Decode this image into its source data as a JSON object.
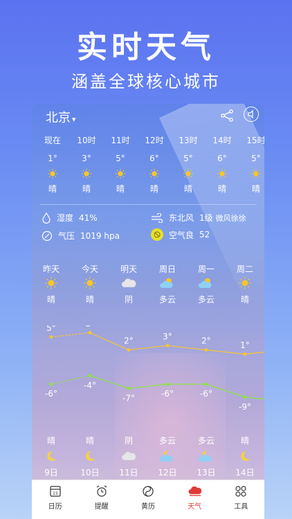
{
  "promo": {
    "title": "实时天气",
    "subtitle": "涵盖全球核心城市"
  },
  "header": {
    "city": "北京",
    "city_dropdown_icon": "chevron-down-icon",
    "share_icon": "share-icon",
    "sound_icon": "speaker-icon"
  },
  "hourly": [
    {
      "time": "现在",
      "temp": "1°",
      "cond": "晴",
      "icon": "sun-icon"
    },
    {
      "time": "10时",
      "temp": "3°",
      "cond": "晴",
      "icon": "sun-icon"
    },
    {
      "time": "11时",
      "temp": "5°",
      "cond": "晴",
      "icon": "sun-icon"
    },
    {
      "time": "12时",
      "temp": "6°",
      "cond": "晴",
      "icon": "sun-icon"
    },
    {
      "time": "13时",
      "temp": "5°",
      "cond": "晴",
      "icon": "sun-icon"
    },
    {
      "time": "14时",
      "temp": "6°",
      "cond": "晴",
      "icon": "sun-icon"
    },
    {
      "time": "15时",
      "temp": "5°",
      "cond": "晴",
      "icon": "sun-icon"
    }
  ],
  "details": {
    "humidity_label": "湿度",
    "humidity_value": "41%",
    "wind_label": "东北风",
    "wind_level": "1级",
    "wind_desc": "微风徐徐",
    "pressure_label": "气压",
    "pressure_value": "1019 hpa",
    "air_label": "空气良",
    "air_value": "52"
  },
  "daily": [
    {
      "day": "昨天",
      "cond": "晴",
      "icon": "sun-icon"
    },
    {
      "day": "今天",
      "cond": "晴",
      "icon": "sun-icon"
    },
    {
      "day": "明天",
      "cond": "阴",
      "icon": "cloud-icon"
    },
    {
      "day": "周日",
      "cond": "多云",
      "icon": "partly-cloudy-icon"
    },
    {
      "day": "周一",
      "cond": "多云",
      "icon": "partly-cloudy-icon"
    },
    {
      "day": "周二",
      "cond": "晴",
      "icon": "sun-icon"
    }
  ],
  "chart_data": {
    "type": "line",
    "categories": [
      "昨天",
      "今天",
      "明天",
      "周日",
      "周一",
      "周二"
    ],
    "series": [
      {
        "values": [
          5,
          6,
          2,
          3,
          2,
          1
        ],
        "color": "#f2c33a"
      },
      {
        "values": [
          -6,
          -4,
          -7,
          -6,
          -6,
          -9
        ],
        "color": "#8fe04a"
      }
    ],
    "high_labels": [
      "5°",
      "6°",
      "2°",
      "3°",
      "2°",
      "1°"
    ],
    "low_labels": [
      "-6°",
      "-4°",
      "-7°",
      "-6°",
      "-6°",
      "-9°"
    ]
  },
  "night": [
    {
      "cond": "晴",
      "date": "9日",
      "icon": "moon-icon"
    },
    {
      "cond": "晴",
      "date": "10日",
      "icon": "moon-icon"
    },
    {
      "cond": "阴",
      "date": "11日",
      "icon": "cloud-icon"
    },
    {
      "cond": "多云",
      "date": "12日",
      "icon": "moon-cloud-icon"
    },
    {
      "cond": "多云",
      "date": "13日",
      "icon": "moon-cloud-icon"
    },
    {
      "cond": "晴",
      "date": "14日",
      "icon": "moon-icon"
    }
  ],
  "tabs": [
    {
      "label": "日历",
      "icon": "calendar-icon",
      "icon_text": "15"
    },
    {
      "label": "提醒",
      "icon": "alarm-icon"
    },
    {
      "label": "黄历",
      "icon": "almanac-icon"
    },
    {
      "label": "天气",
      "icon": "weather-icon",
      "active": true
    },
    {
      "label": "工具",
      "icon": "tools-icon"
    }
  ],
  "colors": {
    "accent": "#e23a3a",
    "high_line": "#f2c33a",
    "low_line": "#8fe04a",
    "air_badge": "#e6e22a"
  }
}
